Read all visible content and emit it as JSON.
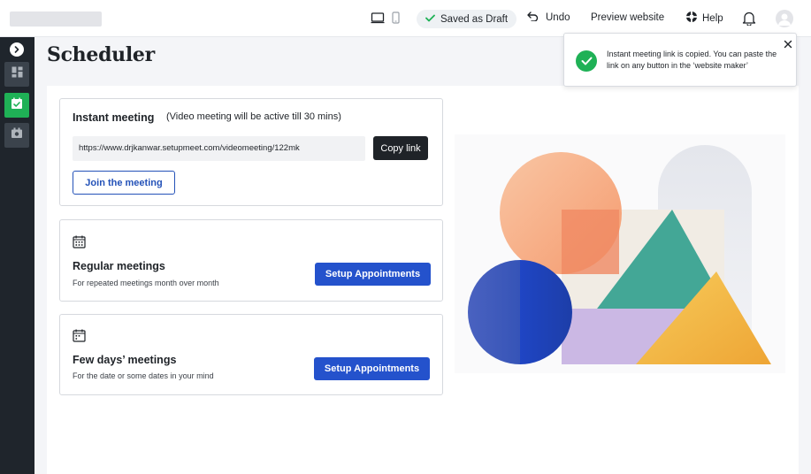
{
  "topbar": {
    "saved_label": "Saved as Draft",
    "undo_label": "Undo",
    "preview_label": "Preview website",
    "help_label": "Help",
    "icons": [
      "desktop-icon",
      "mobile-icon",
      "check-icon",
      "undo-icon",
      "lifebuoy-icon",
      "bell-icon",
      "user-avatar-icon"
    ]
  },
  "sidebar": {
    "items": [
      {
        "name": "expand",
        "icon": "chevron-right-icon",
        "active": false
      },
      {
        "name": "dashboard",
        "icon": "dashboard-icon",
        "active": false
      },
      {
        "name": "scheduler",
        "icon": "calendar-check-icon",
        "active": true
      },
      {
        "name": "media",
        "icon": "camera-icon",
        "active": false
      }
    ]
  },
  "page": {
    "title": "Scheduler"
  },
  "instant_meeting": {
    "title": "Instant meeting",
    "subtitle": "(Video meeting will be active till 30 mins)",
    "url": "https://www.drjkanwar.setupmeet.com/videomeeting/122mk",
    "copy_label": "Copy link",
    "join_label": "Join the meeting"
  },
  "regular_meetings": {
    "title": "Regular meetings",
    "description": "For repeated meetings month over month",
    "button_label": "Setup Appointments"
  },
  "few_days_meetings": {
    "title": "Few days’ meetings",
    "description": "For the date or some dates in your mind",
    "button_label": "Setup Appointments"
  },
  "toast": {
    "message": "Instant meeting link is copied. You can paste the link on any button in the ‘website maker’"
  },
  "colors": {
    "accent_blue": "#2452cc",
    "success_green": "#1fb156",
    "sidebar_bg": "#1f252c"
  }
}
